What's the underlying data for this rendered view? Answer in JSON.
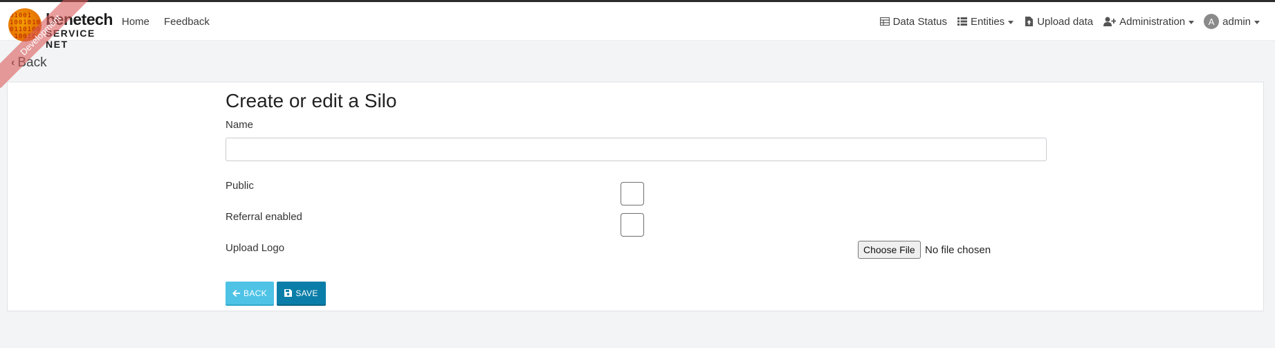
{
  "app": {
    "brand_top": "benetech",
    "brand_bottom": "SERVICE NET",
    "ribbon": "Development"
  },
  "nav": {
    "left": [
      "Home",
      "Feedback"
    ],
    "data_status": "Data Status",
    "entities": "Entities",
    "upload_data": "Upload data",
    "administration": "Administration",
    "avatar_letter": "A",
    "user": "admin"
  },
  "page": {
    "back_link": "Back",
    "title": "Create or edit a Silo"
  },
  "form": {
    "name_label": "Name",
    "name_value": "",
    "public_label": "Public",
    "public_checked": false,
    "referral_label": "Referral enabled",
    "referral_checked": false,
    "logo_label": "Upload Logo",
    "file_button": "Choose File",
    "file_status": "No file chosen"
  },
  "actions": {
    "back": "BACK",
    "save": "SAVE"
  },
  "colors": {
    "back_button": "#4ec3e6",
    "save_button": "#0a7ea8",
    "ribbon": "#da5a5a"
  },
  "icons": {
    "data_status": "table-icon",
    "entities": "list-icon",
    "upload": "file-upload-icon",
    "administration": "user-plus-icon",
    "back": "arrow-left-icon",
    "save": "floppy-disk-icon"
  }
}
